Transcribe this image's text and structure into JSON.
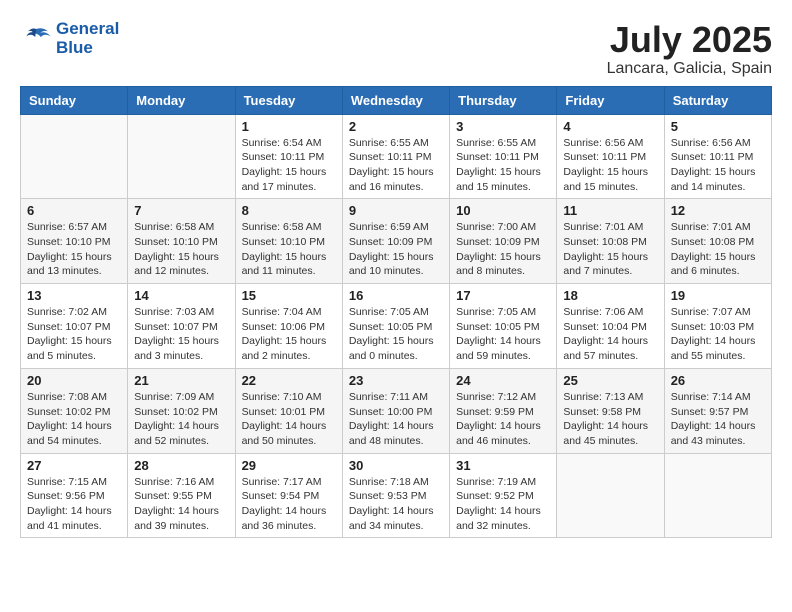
{
  "logo": {
    "line1": "General",
    "line2": "Blue"
  },
  "title": "July 2025",
  "location": "Lancara, Galicia, Spain",
  "weekdays": [
    "Sunday",
    "Monday",
    "Tuesday",
    "Wednesday",
    "Thursday",
    "Friday",
    "Saturday"
  ],
  "weeks": [
    [
      {
        "day": "",
        "info": ""
      },
      {
        "day": "",
        "info": ""
      },
      {
        "day": "1",
        "info": "Sunrise: 6:54 AM\nSunset: 10:11 PM\nDaylight: 15 hours\nand 17 minutes."
      },
      {
        "day": "2",
        "info": "Sunrise: 6:55 AM\nSunset: 10:11 PM\nDaylight: 15 hours\nand 16 minutes."
      },
      {
        "day": "3",
        "info": "Sunrise: 6:55 AM\nSunset: 10:11 PM\nDaylight: 15 hours\nand 15 minutes."
      },
      {
        "day": "4",
        "info": "Sunrise: 6:56 AM\nSunset: 10:11 PM\nDaylight: 15 hours\nand 15 minutes."
      },
      {
        "day": "5",
        "info": "Sunrise: 6:56 AM\nSunset: 10:11 PM\nDaylight: 15 hours\nand 14 minutes."
      }
    ],
    [
      {
        "day": "6",
        "info": "Sunrise: 6:57 AM\nSunset: 10:10 PM\nDaylight: 15 hours\nand 13 minutes."
      },
      {
        "day": "7",
        "info": "Sunrise: 6:58 AM\nSunset: 10:10 PM\nDaylight: 15 hours\nand 12 minutes."
      },
      {
        "day": "8",
        "info": "Sunrise: 6:58 AM\nSunset: 10:10 PM\nDaylight: 15 hours\nand 11 minutes."
      },
      {
        "day": "9",
        "info": "Sunrise: 6:59 AM\nSunset: 10:09 PM\nDaylight: 15 hours\nand 10 minutes."
      },
      {
        "day": "10",
        "info": "Sunrise: 7:00 AM\nSunset: 10:09 PM\nDaylight: 15 hours\nand 8 minutes."
      },
      {
        "day": "11",
        "info": "Sunrise: 7:01 AM\nSunset: 10:08 PM\nDaylight: 15 hours\nand 7 minutes."
      },
      {
        "day": "12",
        "info": "Sunrise: 7:01 AM\nSunset: 10:08 PM\nDaylight: 15 hours\nand 6 minutes."
      }
    ],
    [
      {
        "day": "13",
        "info": "Sunrise: 7:02 AM\nSunset: 10:07 PM\nDaylight: 15 hours\nand 5 minutes."
      },
      {
        "day": "14",
        "info": "Sunrise: 7:03 AM\nSunset: 10:07 PM\nDaylight: 15 hours\nand 3 minutes."
      },
      {
        "day": "15",
        "info": "Sunrise: 7:04 AM\nSunset: 10:06 PM\nDaylight: 15 hours\nand 2 minutes."
      },
      {
        "day": "16",
        "info": "Sunrise: 7:05 AM\nSunset: 10:05 PM\nDaylight: 15 hours\nand 0 minutes."
      },
      {
        "day": "17",
        "info": "Sunrise: 7:05 AM\nSunset: 10:05 PM\nDaylight: 14 hours\nand 59 minutes."
      },
      {
        "day": "18",
        "info": "Sunrise: 7:06 AM\nSunset: 10:04 PM\nDaylight: 14 hours\nand 57 minutes."
      },
      {
        "day": "19",
        "info": "Sunrise: 7:07 AM\nSunset: 10:03 PM\nDaylight: 14 hours\nand 55 minutes."
      }
    ],
    [
      {
        "day": "20",
        "info": "Sunrise: 7:08 AM\nSunset: 10:02 PM\nDaylight: 14 hours\nand 54 minutes."
      },
      {
        "day": "21",
        "info": "Sunrise: 7:09 AM\nSunset: 10:02 PM\nDaylight: 14 hours\nand 52 minutes."
      },
      {
        "day": "22",
        "info": "Sunrise: 7:10 AM\nSunset: 10:01 PM\nDaylight: 14 hours\nand 50 minutes."
      },
      {
        "day": "23",
        "info": "Sunrise: 7:11 AM\nSunset: 10:00 PM\nDaylight: 14 hours\nand 48 minutes."
      },
      {
        "day": "24",
        "info": "Sunrise: 7:12 AM\nSunset: 9:59 PM\nDaylight: 14 hours\nand 46 minutes."
      },
      {
        "day": "25",
        "info": "Sunrise: 7:13 AM\nSunset: 9:58 PM\nDaylight: 14 hours\nand 45 minutes."
      },
      {
        "day": "26",
        "info": "Sunrise: 7:14 AM\nSunset: 9:57 PM\nDaylight: 14 hours\nand 43 minutes."
      }
    ],
    [
      {
        "day": "27",
        "info": "Sunrise: 7:15 AM\nSunset: 9:56 PM\nDaylight: 14 hours\nand 41 minutes."
      },
      {
        "day": "28",
        "info": "Sunrise: 7:16 AM\nSunset: 9:55 PM\nDaylight: 14 hours\nand 39 minutes."
      },
      {
        "day": "29",
        "info": "Sunrise: 7:17 AM\nSunset: 9:54 PM\nDaylight: 14 hours\nand 36 minutes."
      },
      {
        "day": "30",
        "info": "Sunrise: 7:18 AM\nSunset: 9:53 PM\nDaylight: 14 hours\nand 34 minutes."
      },
      {
        "day": "31",
        "info": "Sunrise: 7:19 AM\nSunset: 9:52 PM\nDaylight: 14 hours\nand 32 minutes."
      },
      {
        "day": "",
        "info": ""
      },
      {
        "day": "",
        "info": ""
      }
    ]
  ]
}
